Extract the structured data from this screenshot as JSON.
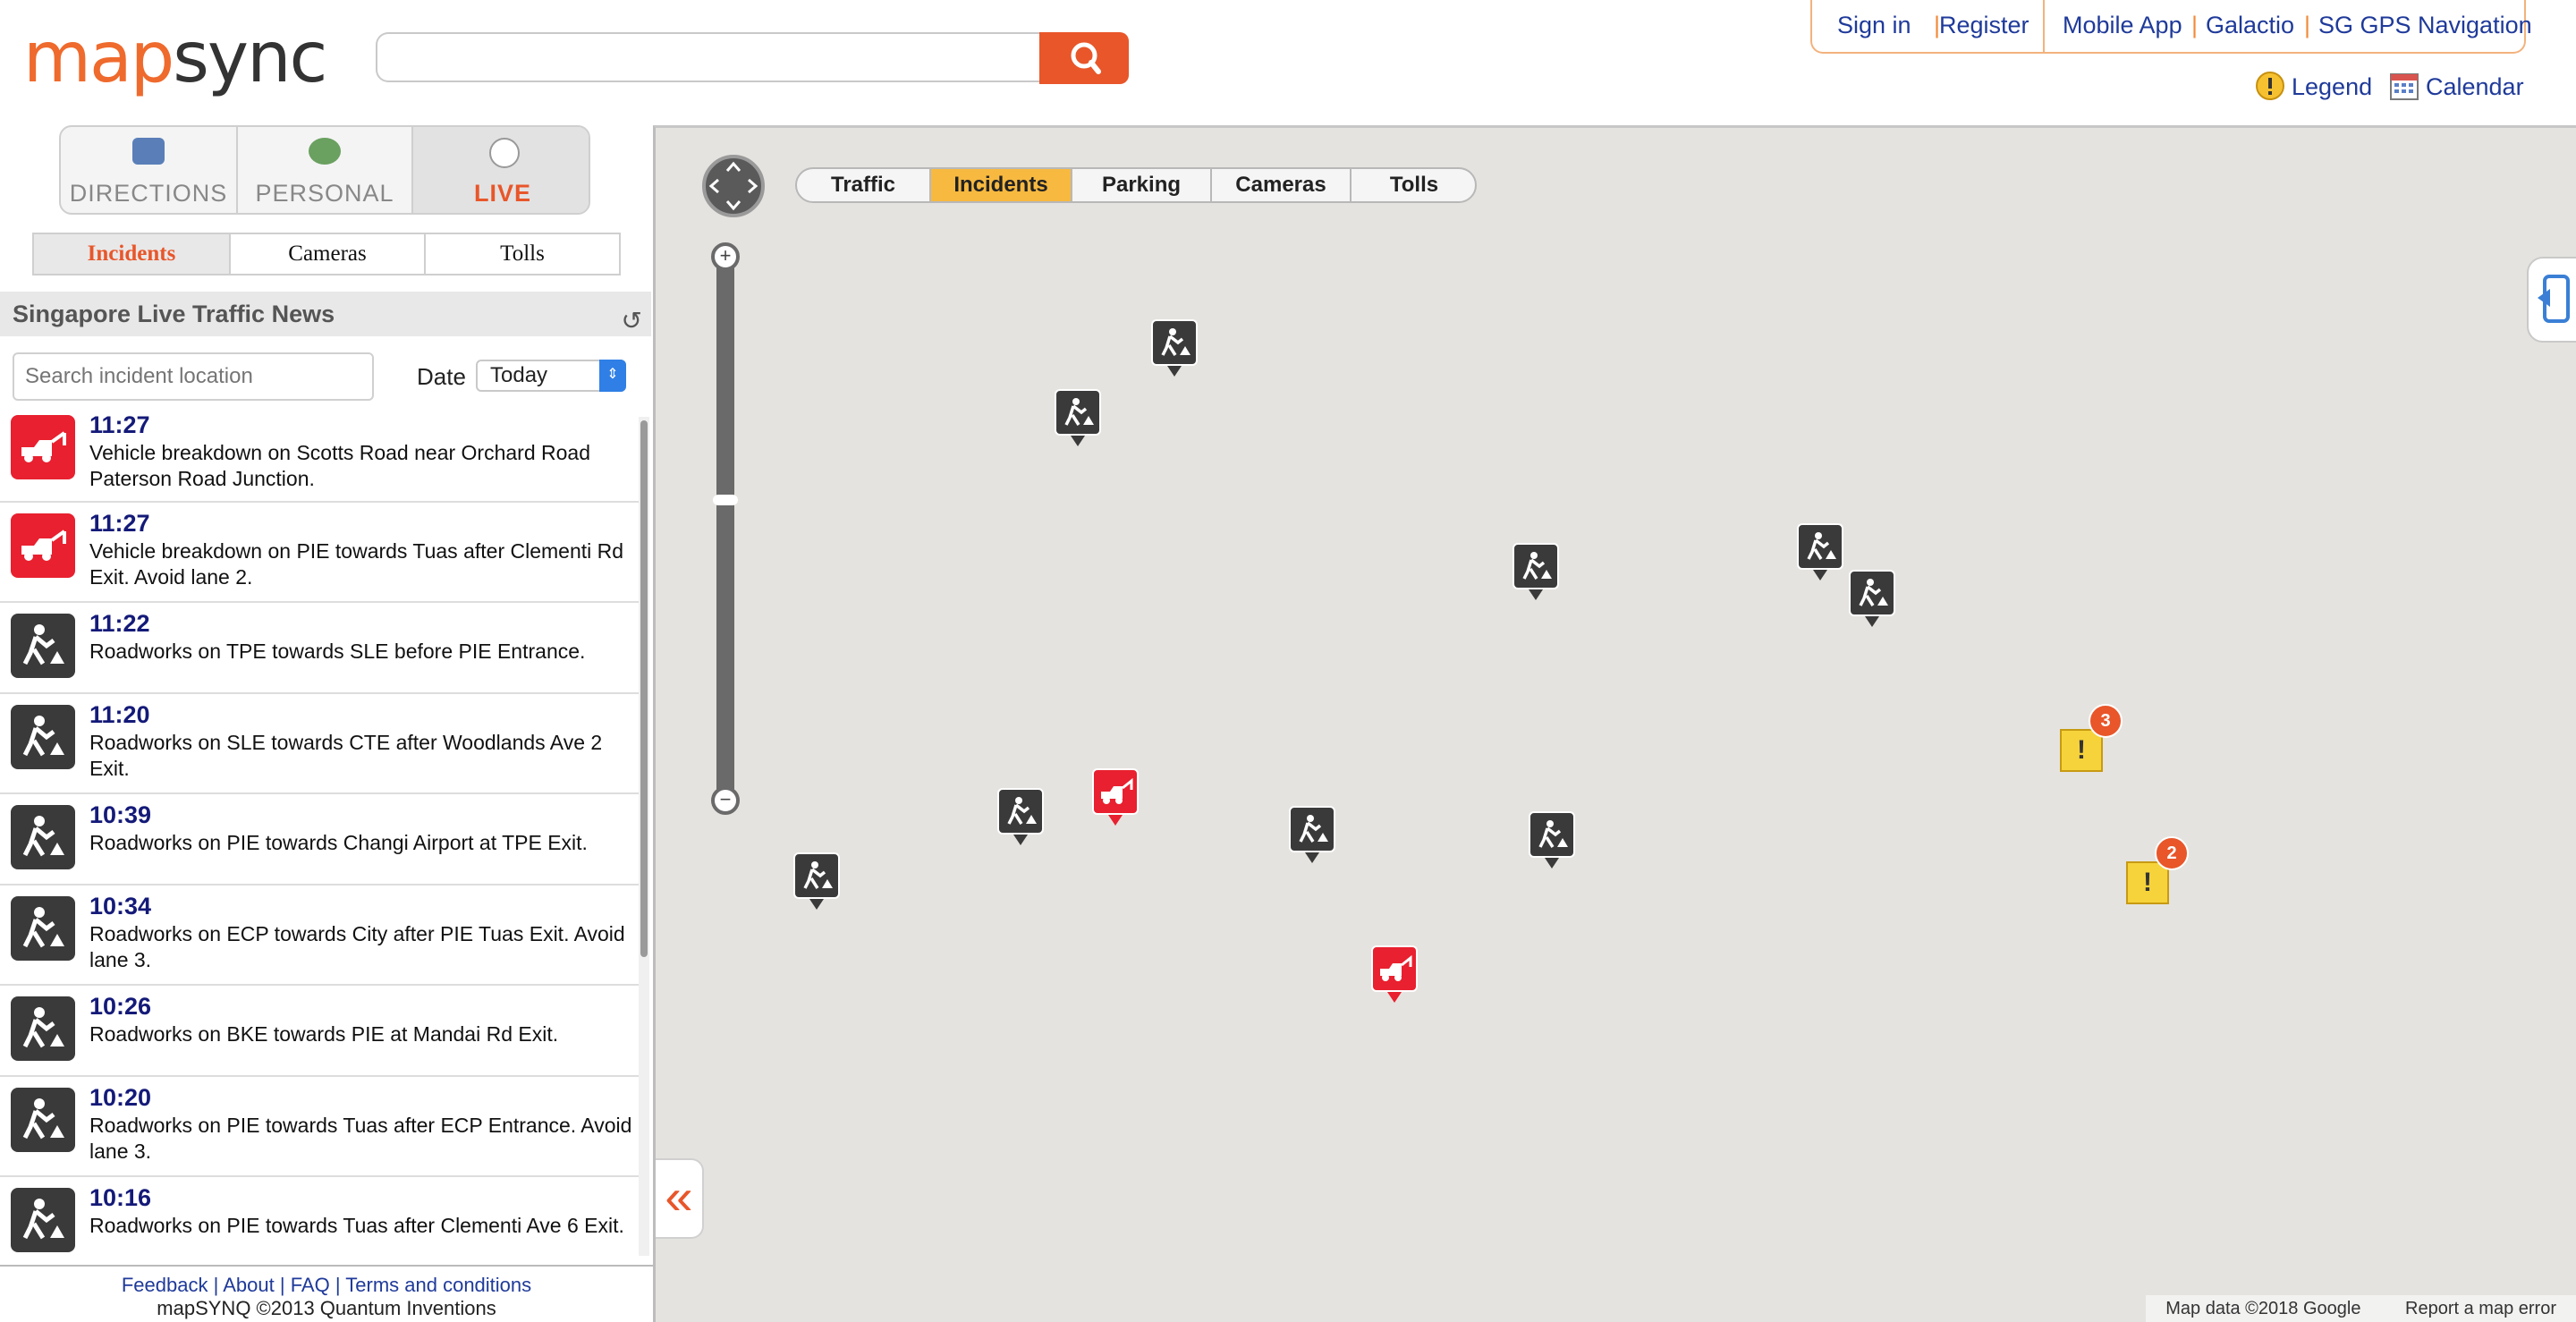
{
  "header": {
    "logo_part1": "map",
    "logo_part2": "sync",
    "search_value": "",
    "links": {
      "sign_in": "Sign in",
      "register": "Register",
      "mobile_app": "Mobile App",
      "galactio": "Galactio",
      "sg_gps": "SG GPS Navigation",
      "separator": "|"
    },
    "legend": "Legend",
    "calendar": "Calendar"
  },
  "mode_tabs": [
    {
      "label": "DIRECTIONS",
      "icon": "car-icon"
    },
    {
      "label": "PERSONAL",
      "icon": "person-icon"
    },
    {
      "label": "LIVE",
      "icon": "clock-icon",
      "active": true
    }
  ],
  "sub_tabs": [
    {
      "label": "Incidents",
      "active": true
    },
    {
      "label": "Cameras"
    },
    {
      "label": "Tolls"
    }
  ],
  "news": {
    "title": "Singapore Live Traffic News",
    "search_placeholder": "Search incident location",
    "date_label": "Date",
    "date_value": "Today"
  },
  "incidents": [
    {
      "time": "11:27",
      "type": "tow",
      "text": "Vehicle breakdown on Scotts Road near Orchard Road Paterson Road Junction."
    },
    {
      "time": "11:27",
      "type": "tow",
      "text": "Vehicle breakdown on PIE towards Tuas after Clementi Rd Exit. Avoid lane 2."
    },
    {
      "time": "11:22",
      "type": "roadworks",
      "text": "Roadworks on TPE towards SLE before PIE Entrance."
    },
    {
      "time": "11:20",
      "type": "roadworks",
      "text": "Roadworks on SLE towards CTE after Woodlands Ave 2 Exit."
    },
    {
      "time": "10:39",
      "type": "roadworks",
      "text": "Roadworks on PIE towards Changi Airport at TPE Exit."
    },
    {
      "time": "10:34",
      "type": "roadworks",
      "text": "Roadworks on ECP towards City after PIE Tuas Exit. Avoid lane 3."
    },
    {
      "time": "10:26",
      "type": "roadworks",
      "text": "Roadworks on BKE towards PIE at Mandai Rd Exit."
    },
    {
      "time": "10:20",
      "type": "roadworks",
      "text": "Roadworks on PIE towards Tuas after ECP Entrance. Avoid lane 3."
    },
    {
      "time": "10:16",
      "type": "roadworks",
      "text": "Roadworks on PIE towards Tuas after Clementi Ave 6 Exit."
    }
  ],
  "footer": {
    "feedback": "Feedback",
    "about": "About",
    "faq": "FAQ",
    "terms": "Terms and conditions",
    "separator": "|",
    "copyright": "mapSYNQ ©2013 Quantum Inventions"
  },
  "map": {
    "tabs": [
      {
        "label": "Traffic"
      },
      {
        "label": "Incidents",
        "active": true
      },
      {
        "label": "Parking"
      },
      {
        "label": "Cameras"
      },
      {
        "label": "Tolls"
      }
    ],
    "zoom_in": "+",
    "zoom_out": "−",
    "collapse": "«",
    "clusters": [
      {
        "count": "3",
        "symbol": "!"
      },
      {
        "count": "2",
        "symbol": "!"
      }
    ],
    "attribution": {
      "data": "Map data ©2018 Google",
      "report": "Report a map error"
    }
  },
  "colors": {
    "brand_orange": "#e8562a",
    "link_blue": "#1f3a9a",
    "time_navy": "#141a78",
    "tow_red": "#e8202f",
    "roadworks_dark": "#3a3a3a",
    "active_tab_yellow": "#f7b940"
  }
}
